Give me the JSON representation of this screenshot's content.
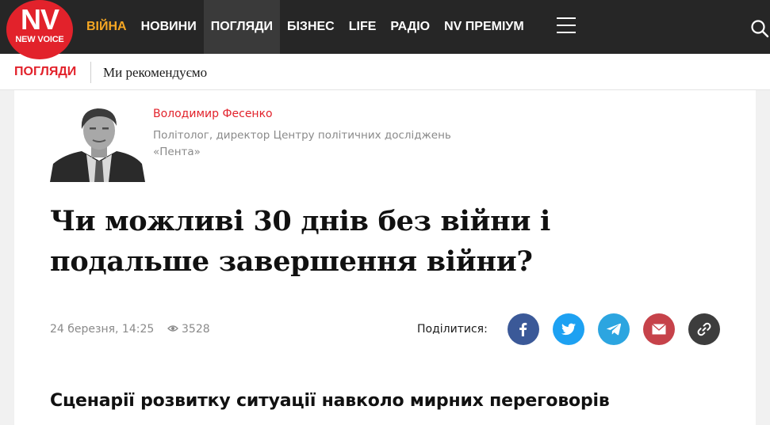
{
  "logo": {
    "main": "NV",
    "sub": "NEW VOICE"
  },
  "nav": {
    "items": [
      {
        "label": "ВІЙНА"
      },
      {
        "label": "НОВИНИ"
      },
      {
        "label": "ПОГЛЯДИ"
      },
      {
        "label": "БІЗНЕС"
      },
      {
        "label": "LIFE"
      },
      {
        "label": "РАДІО"
      },
      {
        "label": "NV ПРЕМІУМ"
      }
    ],
    "menu_icon": "hamburger-icon",
    "search_icon": "search-icon"
  },
  "subnav": {
    "section": "ПОГЛЯДИ",
    "link": "Ми рекомендуємо"
  },
  "author": {
    "name": "Володимир Фесенко",
    "description": "Політолог, директор Центру політичних досліджень «Пента»"
  },
  "article": {
    "title": "Чи можливі 30 днів без війни і подальше завершення війни?",
    "date": "24 березня, 14:25",
    "views": "3528",
    "subheading": "Сценарії розвитку ситуації навколо мирних переговорів"
  },
  "share": {
    "label": "Поділитися:",
    "buttons": [
      {
        "network": "facebook",
        "icon": "facebook-icon",
        "color": "#3b5998"
      },
      {
        "network": "twitter",
        "icon": "twitter-icon",
        "color": "#1da1f2"
      },
      {
        "network": "telegram",
        "icon": "telegram-icon",
        "color": "#2ca5e0"
      },
      {
        "network": "email",
        "icon": "mail-icon",
        "color": "#c6424a"
      },
      {
        "network": "link",
        "icon": "link-icon",
        "color": "#3d3d3d"
      }
    ]
  },
  "colors": {
    "brand_red": "#e2222b",
    "nav_bg": "#262626",
    "accent_orange": "#f5a623"
  }
}
